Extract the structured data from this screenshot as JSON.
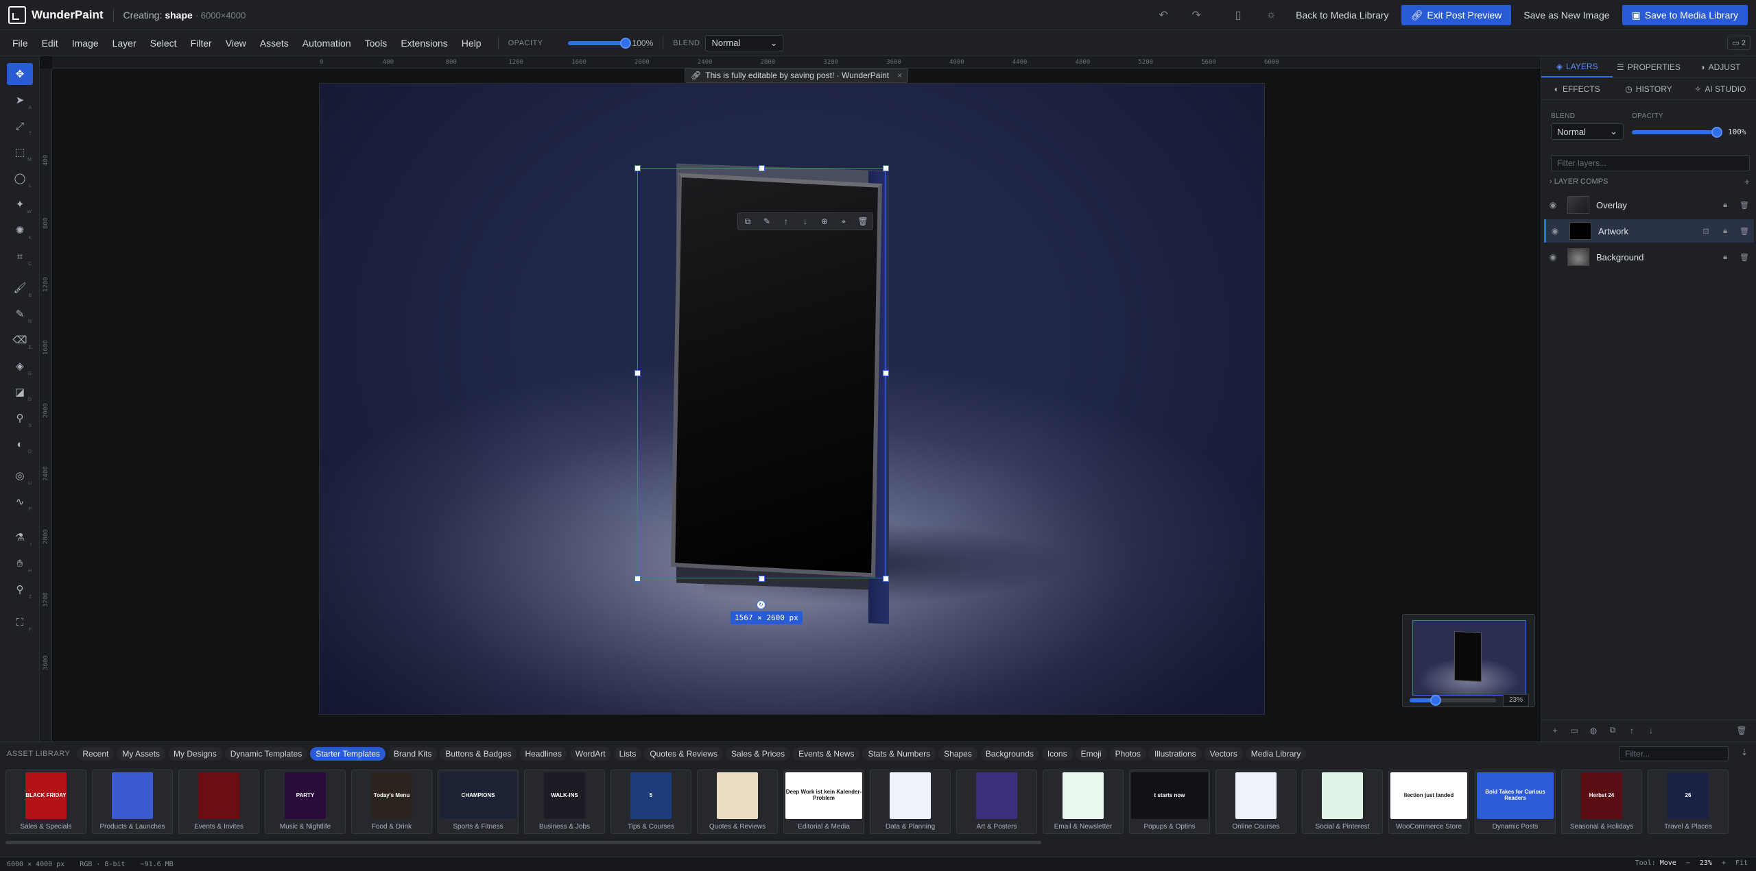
{
  "app": {
    "name": "WunderPaint",
    "creating_label": "Creating:",
    "doc_name": "shape",
    "doc_size": "· 6000×4000"
  },
  "titlebar": {
    "back": "Back to Media Library",
    "exit_preview": "Exit Post Preview",
    "save_new": "Save as New Image",
    "save_library": "Save to Media Library"
  },
  "menu": [
    "File",
    "Edit",
    "Image",
    "Layer",
    "Select",
    "Filter",
    "View",
    "Assets",
    "Automation",
    "Tools",
    "Extensions",
    "Help"
  ],
  "menubar": {
    "opacity_label": "OPACITY",
    "opacity_value": "100%",
    "opacity_fraction": 1.0,
    "blend_label": "BLEND",
    "blend_value": "Normal",
    "windows_count": "2"
  },
  "ruler": {
    "top": [
      "0",
      "400",
      "800",
      "1200",
      "1600",
      "2000",
      "2400",
      "2800",
      "3200",
      "3600",
      "4000",
      "4400",
      "4800",
      "5200",
      "5600",
      "6000"
    ],
    "left": [
      "400",
      "800",
      "1200",
      "1600",
      "2000",
      "2400",
      "2800",
      "3200",
      "3600"
    ]
  },
  "canvas": {
    "toast": "This is fully editable by saving post! · WunderPaint",
    "dims": "1567 × 2600 px"
  },
  "navigator": {
    "zoom": "23%",
    "zoom_fraction": 0.3
  },
  "rpanel": {
    "tabs": [
      "LAYERS",
      "PROPERTIES",
      "ADJUST"
    ],
    "tabs2": [
      "EFFECTS",
      "HISTORY",
      "AI STUDIO"
    ],
    "blend_label": "BLEND",
    "blend_value": "Normal",
    "opacity_label": "OPACITY",
    "opacity_value": "100%",
    "opacity_fraction": 1.0,
    "filter_placeholder": "Filter layers...",
    "layer_comps": "LAYER COMPS",
    "layers": [
      {
        "name": "Overlay"
      },
      {
        "name": "Artwork",
        "active": true
      },
      {
        "name": "Background"
      }
    ]
  },
  "assets": {
    "title": "ASSET LIBRARY",
    "tabs": [
      "Recent",
      "My Assets",
      "My Designs",
      "Dynamic Templates",
      "Starter Templates",
      "Brand Kits",
      "Buttons & Badges",
      "Headlines",
      "WordArt",
      "Lists",
      "Quotes & Reviews",
      "Sales & Prices",
      "Events & News",
      "Stats & Numbers",
      "Shapes",
      "Backgrounds",
      "Icons",
      "Emoji",
      "Photos",
      "Illustrations",
      "Vectors",
      "Media Library"
    ],
    "active_tab": "Starter Templates",
    "filter_placeholder": "Filter...",
    "cards": [
      {
        "label": "Sales & Specials",
        "text": "BLACK FRIDAY",
        "bg": "#b31217"
      },
      {
        "label": "Products & Launches",
        "text": "",
        "bg": "#3c5bd1"
      },
      {
        "label": "Events & Invites",
        "text": "",
        "bg": "#6b0d12"
      },
      {
        "label": "Music & Nightlife",
        "text": "PARTY",
        "bg": "#2a0b3b"
      },
      {
        "label": "Food & Drink",
        "text": "Today's Menu",
        "bg": "#2b241c"
      },
      {
        "label": "Sports & Fitness",
        "text": "CHAMPIONS",
        "bg": "#1b2233",
        "wide": true
      },
      {
        "label": "Business & Jobs",
        "text": "WALK-INS",
        "bg": "#1c1d24"
      },
      {
        "label": "Tips & Courses",
        "text": "5",
        "bg": "#1d3c7a"
      },
      {
        "label": "Quotes & Reviews",
        "text": "",
        "bg": "#e8dcc2"
      },
      {
        "label": "Editorial & Media",
        "text": "Deep Work ist kein Kalender-Problem",
        "bg": "#ffffff",
        "dark": true,
        "wide": true
      },
      {
        "label": "Data & Planning",
        "text": "",
        "bg": "#eef2fb"
      },
      {
        "label": "Art & Posters",
        "text": "",
        "bg": "#3a2f7a"
      },
      {
        "label": "Email & Newsletter",
        "text": "",
        "bg": "#eaf7ef"
      },
      {
        "label": "Popups & Optins",
        "text": "t starts now",
        "bg": "#101114",
        "wide": true
      },
      {
        "label": "Online Courses",
        "text": "",
        "bg": "#eef2fb"
      },
      {
        "label": "Social & Pinterest",
        "text": "",
        "bg": "#dff3e6"
      },
      {
        "label": "WooCommerce Store",
        "text": "llection just landed",
        "bg": "#ffffff",
        "dark": true,
        "wide": true
      },
      {
        "label": "Dynamic Posts",
        "text": "Bold Takes for Curious Readers",
        "bg": "#2e5bd8",
        "wide": true
      },
      {
        "label": "Seasonal & Holidays",
        "text": "Herbst 24",
        "bg": "#5a0e13"
      },
      {
        "label": "Travel & Places",
        "text": "26",
        "bg": "#1a2244"
      }
    ]
  },
  "status": {
    "size": "6000 × 4000 px",
    "mode": "RGB · 8-bit",
    "mem": "~91.6 MB",
    "tool_label": "Tool:",
    "tool": "Move",
    "zoom": "23%",
    "fit": "Fit",
    "minus": "−",
    "plus": "+"
  }
}
